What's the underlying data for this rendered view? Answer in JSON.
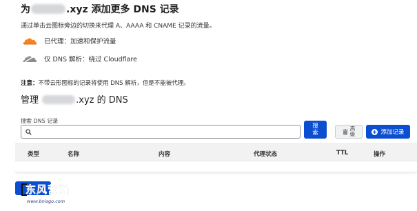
{
  "colors": {
    "accent": "#0b4fd0",
    "proxied_cloud": "#f6821f",
    "dns_only_cloud": "#8a8d91"
  },
  "header": {
    "title_prefix": "为",
    "title_domain_suffix": ".xyz 添加更多 DNS 记录",
    "description": "通过单击云图标旁边的切换来代理 A、AAAA 和 CNAME 记录的流量。"
  },
  "legend": [
    {
      "icon": "orange-cloud-icon",
      "label": "已代理：加速和保护流量"
    },
    {
      "icon": "gray-cloud-icon",
      "label": "仅 DNS 解析：绕过 Cloudflare"
    }
  ],
  "note": {
    "label": "注意：",
    "text": "不带云形图标的记录将使用 DNS 解析，但是不能被代理。"
  },
  "manage": {
    "prefix": "管理",
    "suffix": ".xyz 的 DNS"
  },
  "search": {
    "label": "搜索 DNS 记录",
    "placeholder": "",
    "button_line1": "搜",
    "button_line2": "索"
  },
  "toolbar": {
    "advanced_line1": "高",
    "advanced_line2": "级",
    "add_record": "添加记录"
  },
  "table": {
    "columns": [
      "类型",
      "名称",
      "内容",
      "代理状态",
      "TTL",
      "操作"
    ]
  },
  "watermark": {
    "title": "东风营销",
    "url": "www.bnisgo.com"
  }
}
